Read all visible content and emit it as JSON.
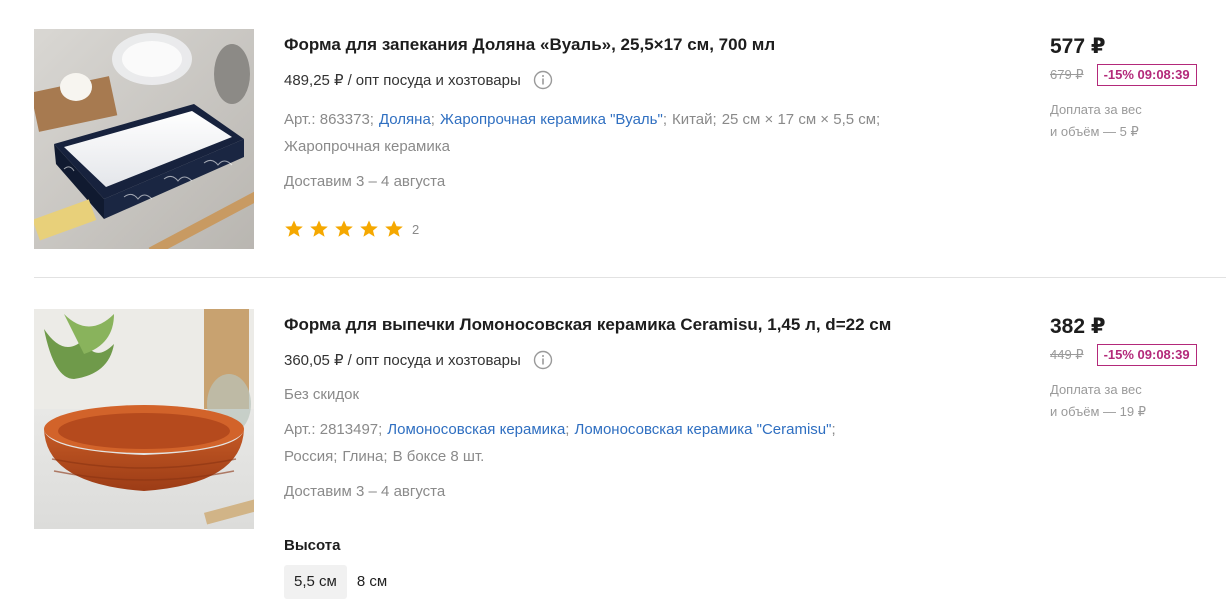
{
  "products": [
    {
      "image_icon": "baking-dish-photo",
      "title": "Форма для запекания Доляна «Вуаль», 25,5×17 см, 700 мл",
      "wholesale_price": "489,25 ₽",
      "wholesale_sep": "/",
      "wholesale_category": "опт посуда и хозтовары",
      "art": "Арт.: 863373;",
      "brand": "Доляна",
      "series": "Жаропрочная керамика \"Вуаль\"",
      "country": "Китай;",
      "dimensions": "25 см × 17 см × 5,5 см;",
      "material": "Жаропрочная керамика",
      "delivery": "Доставим 3 – 4 августа",
      "rating_stars": 5,
      "reviews_count": "2",
      "price": "577 ₽",
      "old_price": "679 ₽",
      "discount_badge": "-15% 09:08:39",
      "surcharge_line1": "Доплата за вес",
      "surcharge_line2": "и объём — 5 ₽"
    },
    {
      "image_icon": "round-baking-dish-photo",
      "title": "Форма для выпечки Ломоносовская керамика Ceramisu, 1,45 л, d=22 см",
      "wholesale_price": "360,05 ₽",
      "wholesale_sep": "/",
      "wholesale_category": "опт посуда и хозтовары",
      "no_discount": "Без скидок",
      "art": "Арт.: 2813497;",
      "brand": "Ломоносовская керамика",
      "series": "Ломоносовская керамика \"Ceramisu\"",
      "country": "Россия;",
      "material": "Глина;",
      "pack": "В боксе 8 шт.",
      "delivery": "Доставим 3 – 4 августа",
      "option_label": "Высота",
      "options": [
        "5,5 см",
        "8 см"
      ],
      "price": "382 ₽",
      "old_price": "449 ₽",
      "discount_badge": "-15% 09:08:39",
      "surcharge_line1": "Доплата за вес",
      "surcharge_line2": "и объём — 19 ₽"
    }
  ],
  "colors": {
    "link": "#2f6fc1",
    "badge": "#b3297a",
    "star": "#f5a800",
    "muted": "#8a8a8a"
  }
}
